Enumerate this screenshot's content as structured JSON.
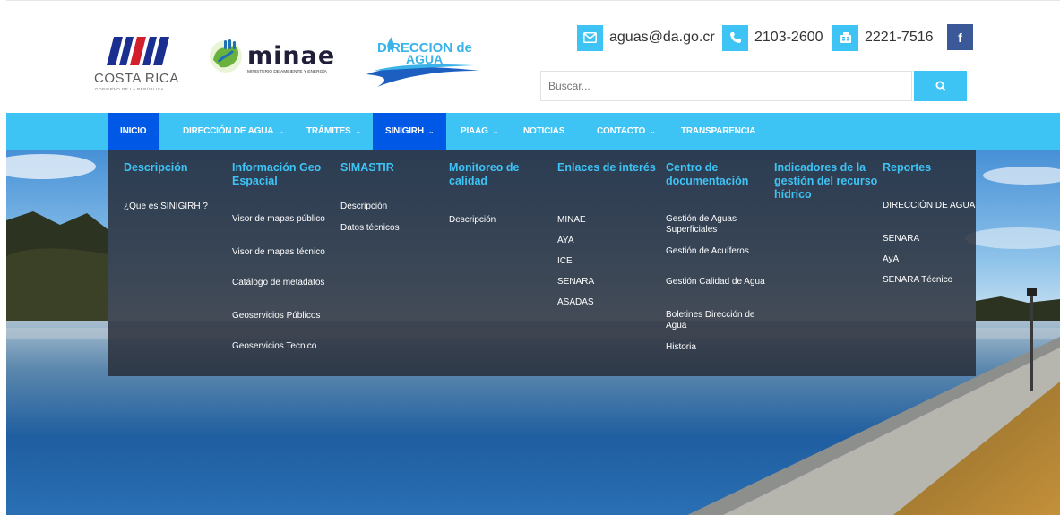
{
  "header": {
    "logos": {
      "costa_rica": {
        "name": "COSTA RICA",
        "sub": "GOBIERNO DE LA REPÚBLICA"
      },
      "minae": {
        "word": "minae",
        "sub": "MINISTERIO DE AMBIENTE Y ENERGÍA"
      },
      "direccion_agua": {
        "line1": "DIRECCION de",
        "line2": "AGUA"
      }
    },
    "contacts": [
      {
        "icon": "envelope-icon",
        "text": "aguas@da.go.cr"
      },
      {
        "icon": "phone-icon",
        "text": "2103-2600"
      },
      {
        "icon": "fax-icon",
        "text": "2221-7516"
      }
    ],
    "facebook": {
      "icon": "facebook-icon",
      "label": "f"
    },
    "search": {
      "placeholder": "Buscar...",
      "button_icon": "search-icon"
    }
  },
  "nav": {
    "items": [
      {
        "label": "INICIO",
        "active": true,
        "dropdown": false
      },
      {
        "label": "DIRECCIÓN DE AGUA",
        "active": false,
        "dropdown": true
      },
      {
        "label": "TRÁMITES",
        "active": false,
        "dropdown": true
      },
      {
        "label": "SINIGIRH",
        "active": true,
        "dropdown": true
      },
      {
        "label": "PIAAG",
        "active": false,
        "dropdown": true
      },
      {
        "label": "NOTICIAS",
        "active": false,
        "dropdown": false
      },
      {
        "label": "CONTACTO",
        "active": false,
        "dropdown": true
      },
      {
        "label": "TRANSPARENCIA",
        "active": false,
        "dropdown": false
      }
    ]
  },
  "mega_menu": {
    "columns": [
      {
        "heading": "Descripción",
        "links": [
          "¿Que es SINIGIRH ?"
        ]
      },
      {
        "heading": "Información Geo Espacial",
        "links": [
          "Visor de mapas público",
          "Visor de mapas técnico",
          "Catálogo de metadatos",
          "Geoservicios Públicos",
          "Geoservicios Tecnico"
        ]
      },
      {
        "heading": "SIMASTIR",
        "links": [
          "Descripción",
          "Datos técnicos"
        ]
      },
      {
        "heading": "Monitoreo de calidad",
        "links": [
          "Descripción"
        ]
      },
      {
        "heading": "Enlaces de interés",
        "links": [
          "MINAE",
          "AYA",
          "ICE",
          "SENARA",
          "ASADAS"
        ]
      },
      {
        "heading": "Centro de documentación",
        "links": [
          "Gestión de Aguas Superficiales",
          "Gestión de Acuíferos",
          "Gestión Calidad de Agua",
          "Boletines Dirección de Agua",
          "Historia"
        ]
      },
      {
        "heading": "Indicadores de la gestión del recurso hídrico",
        "links": []
      },
      {
        "heading": "Reportes",
        "links": [
          "DIRECCIÓN DE AGUA",
          "SENARA",
          "AyA",
          "SENARA Técnico"
        ]
      }
    ]
  },
  "colors": {
    "accent": "#3ec3f5",
    "nav_active": "#0058e6",
    "facebook": "#3b5998",
    "heading": "#3ec3f5"
  }
}
